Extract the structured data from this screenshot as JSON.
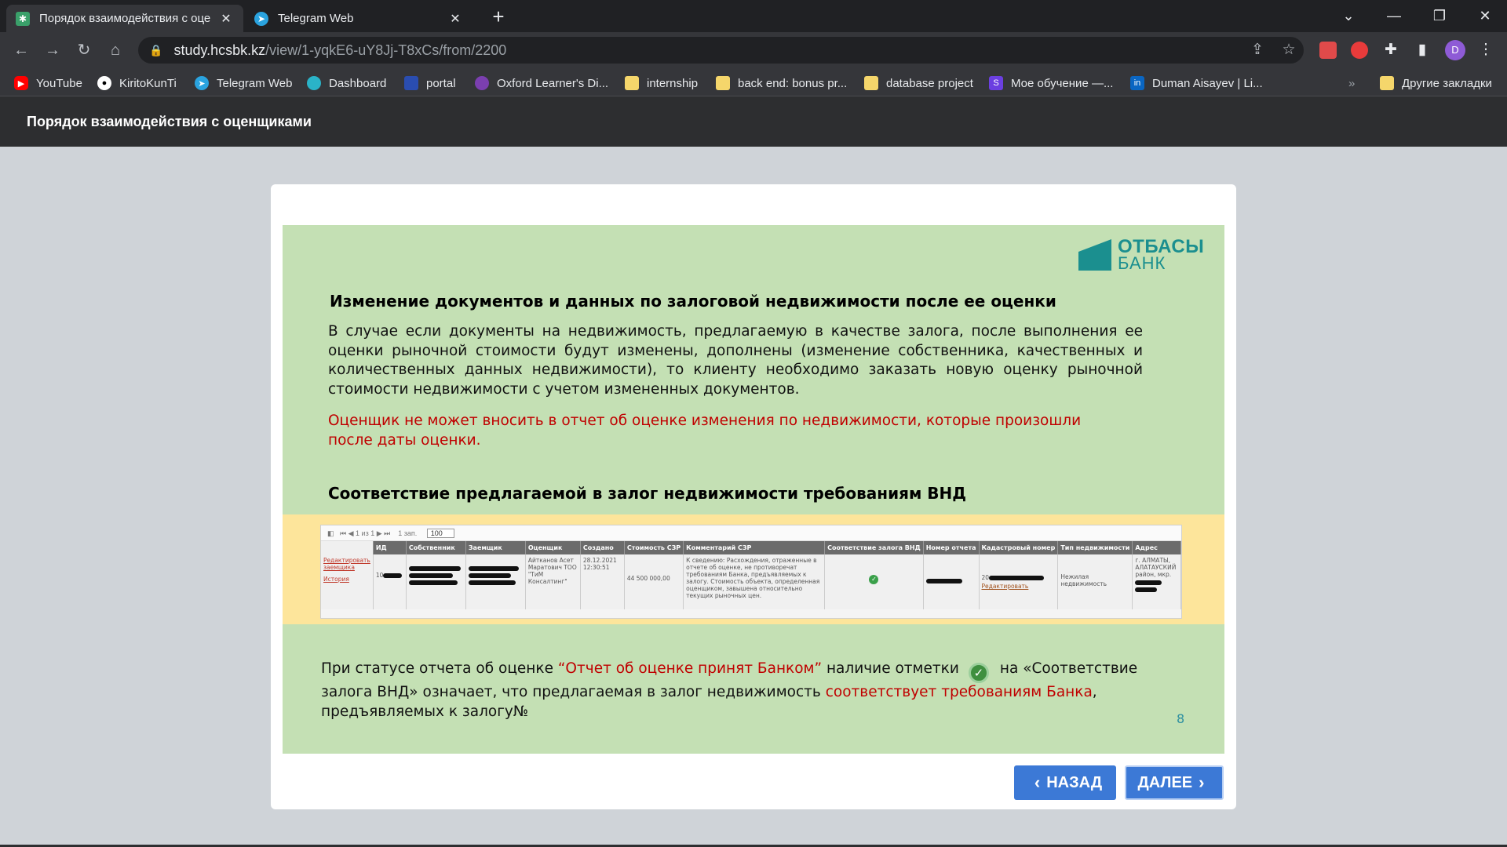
{
  "browser": {
    "tabs": [
      {
        "title": "Порядок взаимодействия с оце",
        "active": true
      },
      {
        "title": "Telegram Web",
        "active": false
      }
    ],
    "url_host": "study.hcsbk.kz",
    "url_path": "/view/1-yqkE6-uY8Jj-T8xCs/from/2200",
    "profile_initial": "D",
    "bookmarks": [
      {
        "label": "YouTube",
        "icon": "youtube-icon",
        "color": "#ff0000"
      },
      {
        "label": "KiritoKunTi",
        "icon": "github-icon",
        "color": "#ffffff"
      },
      {
        "label": "Telegram Web",
        "icon": "telegram-icon",
        "color": "#2aa3df"
      },
      {
        "label": "Dashboard",
        "icon": "dashboard-icon",
        "color": "#2ab3c8"
      },
      {
        "label": "portal",
        "icon": "portal-icon",
        "color": "#2a4db0"
      },
      {
        "label": "Oxford Learner's Di...",
        "icon": "oxford-icon",
        "color": "#7b3fb0"
      },
      {
        "label": "internship",
        "icon": "folder-icon",
        "color": "#f5d66b"
      },
      {
        "label": "back end: bonus pr...",
        "icon": "folder-icon",
        "color": "#f5d66b"
      },
      {
        "label": "database project",
        "icon": "folder-icon",
        "color": "#f5d66b"
      },
      {
        "label": "Мое обучение —...",
        "icon": "s-icon",
        "color": "#6b3fe0"
      },
      {
        "label": "Duman Aisayev | Li...",
        "icon": "linkedin-icon",
        "color": "#0a66c2"
      }
    ],
    "other_bookmarks": "Другие закладки",
    "overflow": "»"
  },
  "app": {
    "header_title": "Порядок взаимодействия с оценщиками"
  },
  "slide": {
    "logo_line1": "ОТБАСЫ",
    "logo_line2": "БАНК",
    "heading1": "Изменение документов и данных по залоговой недвижимости после ее оценки",
    "paragraph": "В случае если документы на недвижимость, предлагаемую в качестве залога, после выполнения ее оценки рыночной стоимости будут изменены, дополнены (изменение собственника, качественных и количественных данных недвижимости), то клиенту необходимо заказать новую оценку рыночной стоимости недвижимости с учетом измененных документов.",
    "warning": "Оценщик не может вносить в отчет об оценке изменения по недвижимости, которые произошли после даты оценки.",
    "heading2": "Соответствие предлагаемой в залог недвижимости требованиям ВНД",
    "screenshot": {
      "pager": "1 из 1",
      "pager_records": "1 зап.",
      "page_size": "100",
      "columns": [
        "ИД",
        "Собственник",
        "Заемщик",
        "Оценщик",
        "Создано",
        "Стоимость СЗР",
        "Комментарий СЗР",
        "Соответствие залога ВНД",
        "Номер отчета",
        "Кадастровый номер",
        "Тип недвижимости",
        "Адрес"
      ],
      "row": {
        "link_edit": "Редактировать заемщика",
        "link_history": "История",
        "id_prefix": "10",
        "appraiser": "Айтканов Асет Маратович ТОО \"ТиМ Консалтинг\"",
        "created": "28.12.2021 12:30:51",
        "cost": "44 500 000,00",
        "comment": "К сведению: Расхождения, отраженные в отчете об оценке, не противоречат требованиям Банка, предъявляемых к залогу. Стоимость объекта, определенная оценщиком, завышена относительно текущих рыночных цен.",
        "cadastre_prefix": "20",
        "cadastre_link": "Редактировать",
        "type": "Нежилая недвижимость",
        "address": "г. АЛМАТЫ, АЛАТАУСКИЙ район, мкр."
      }
    },
    "bottom_text_1": "При статусе отчета об оценке ",
    "bottom_text_status": "“Отчет об оценке принят Банком”",
    "bottom_text_2": "  наличие отметки",
    "bottom_text_3": "на «Соответствие залога ВНД» означает, что предлагаемая в залог недвижимость ",
    "bottom_text_red": "соответствует требованиям Банка",
    "bottom_text_4": ", предъявляемых к залогу№",
    "page_number": "8"
  },
  "nav": {
    "back_label": "НАЗАД",
    "next_label": "ДАЛЕЕ"
  },
  "colors": {
    "slide_bg": "#c4e0b4",
    "band_bg": "#fde59b",
    "button": "#3c79d6",
    "warning_text": "#c00000",
    "brand": "#1b8f8f"
  }
}
